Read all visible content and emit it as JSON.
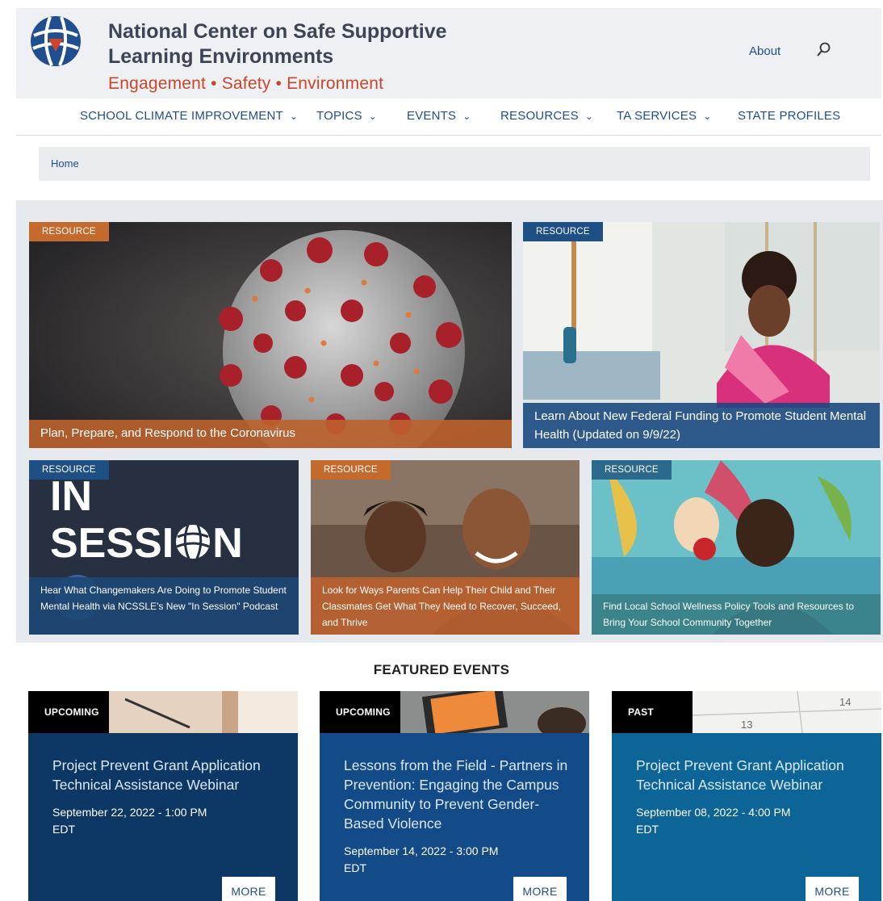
{
  "header": {
    "title": "National Center on Safe Supportive Learning Environments",
    "tagline": "Engagement • Safety • Environment",
    "about_label": "About"
  },
  "nav": {
    "items": [
      {
        "label": "SCHOOL CLIMATE IMPROVEMENT",
        "dropdown": true
      },
      {
        "label": "TOPICS",
        "dropdown": true
      },
      {
        "label": "EVENTS",
        "dropdown": true
      },
      {
        "label": "RESOURCES",
        "dropdown": true
      },
      {
        "label": "TA SERVICES",
        "dropdown": true
      },
      {
        "label": "STATE PROFILES",
        "dropdown": false
      }
    ],
    "caret": "⌄"
  },
  "breadcrumb": {
    "home": "Home"
  },
  "resources": [
    {
      "tag": "RESOURCE",
      "title": "Plan, Prepare, and Respond to the Coronavirus"
    },
    {
      "tag": "RESOURCE",
      "title": "Learn About New Federal Funding to Promote Student Mental Health (Updated on 9/9/22)"
    },
    {
      "tag": "RESOURCE",
      "title": "Hear What Changemakers Are Doing to Promote Student Mental Health via NCSSLE's New \"In Session\" Podcast",
      "art_line1": "IN",
      "art_line2a": "SESSI",
      "art_line2b": "N"
    },
    {
      "tag": "RESOURCE",
      "title": "Look for Ways Parents Can Help Their Child and Their Classmates Get What They Need to Recover, Succeed, and Thrive"
    },
    {
      "tag": "RESOURCE",
      "title": "Find Local School Wellness Policy Tools and Resources to Bring Your School Community Together"
    }
  ],
  "featured": {
    "heading": "FEATURED EVENTS",
    "events": [
      {
        "status": "UPCOMING",
        "title": "Project Prevent Grant Application Technical Assistance Webinar",
        "date": "September 22, 2022 - 1:00 PM",
        "tz": "EDT",
        "more": "MORE",
        "color": "#0d3866"
      },
      {
        "status": "UPCOMING",
        "title": "Lessons from the Field - Partners in Prevention: Engaging the Campus Community to Prevent Gender-Based Violence",
        "date": "September 14, 2022 - 3:00 PM",
        "tz": "EDT",
        "more": "MORE",
        "color": "#134a88"
      },
      {
        "status": "PAST",
        "title": "Project Prevent Grant Application Technical Assistance Webinar",
        "date": "September 08, 2022 - 4:00 PM",
        "tz": "EDT",
        "more": "MORE",
        "color": "#0c6497"
      }
    ]
  },
  "colors": {
    "accent_orange": "#c56a2d",
    "brand_blue": "#1e4f85",
    "tagline_red": "#c8472b"
  }
}
